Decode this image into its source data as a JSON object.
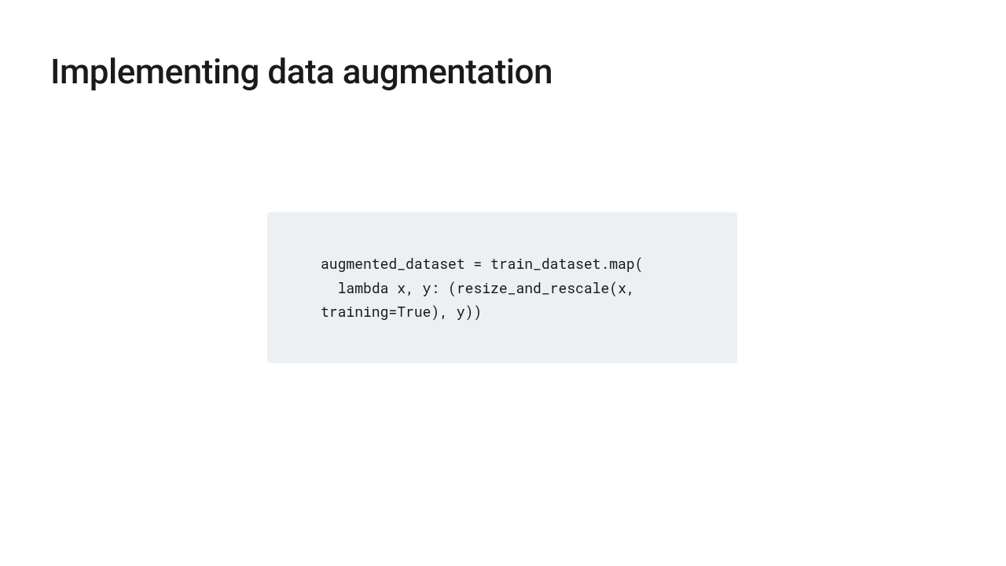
{
  "title": "Implementing data augmentation",
  "code": "augmented_dataset = train_dataset.map(\n  lambda x, y: (resize_and_rescale(x, training=True), y))"
}
